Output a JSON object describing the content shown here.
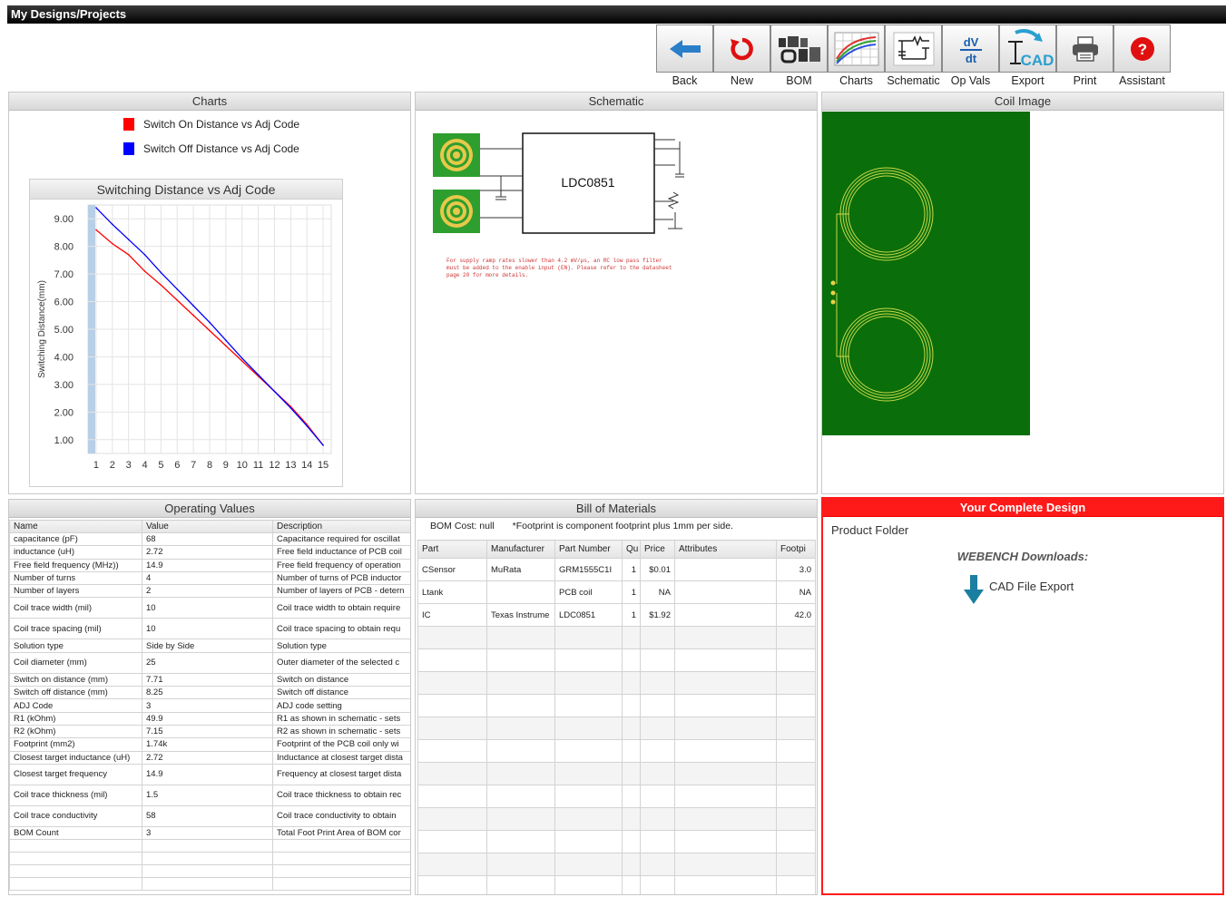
{
  "title": "My Designs/Projects",
  "toolbar": [
    {
      "label": "Back",
      "icon": "back-arrow-icon"
    },
    {
      "label": "New",
      "icon": "refresh-icon"
    },
    {
      "label": "BOM",
      "icon": "bom-icon"
    },
    {
      "label": "Charts",
      "icon": "charts-icon"
    },
    {
      "label": "Schematic",
      "icon": "schematic-icon"
    },
    {
      "label": "Op Vals",
      "icon": "dv-dt-icon"
    },
    {
      "label": "Export",
      "icon": "cad-export-icon"
    },
    {
      "label": "Print",
      "icon": "printer-icon"
    },
    {
      "label": "Assistant",
      "icon": "help-icon"
    }
  ],
  "panels": {
    "charts": "Charts",
    "schematic": "Schematic",
    "coil_image": "Coil Image",
    "operating_values": "Operating Values",
    "bom": "Bill of Materials",
    "complete": "Your Complete Design"
  },
  "colors": {
    "on_series": "#ff0000",
    "off_series": "#0000ff",
    "pcb_green": "#0a6e0a",
    "accent_red": "#ff1a1a"
  },
  "chart_data": {
    "type": "line",
    "title": "Switching Distance vs Adj Code",
    "ylabel": "Switching Distance(mm)",
    "xlabel": "",
    "x": [
      1,
      2,
      3,
      4,
      5,
      6,
      7,
      8,
      9,
      10,
      11,
      12,
      13,
      14,
      15
    ],
    "xlim": [
      0.5,
      15.5
    ],
    "ylim": [
      0.5,
      9.5
    ],
    "yticks": [
      "1.00",
      "2.00",
      "3.00",
      "4.00",
      "5.00",
      "6.00",
      "7.00",
      "8.00",
      "9.00"
    ],
    "legend_position": "top",
    "series": [
      {
        "name": "Switch On Distance vs Adj Code",
        "color": "#ff0000",
        "values": [
          8.6,
          8.1,
          7.7,
          7.1,
          6.6,
          6.05,
          5.5,
          4.95,
          4.4,
          3.85,
          3.3,
          2.75,
          2.2,
          1.55,
          0.8
        ]
      },
      {
        "name": "Switch Off Distance vs Adj Code",
        "color": "#0000ff",
        "values": [
          9.4,
          8.8,
          8.25,
          7.7,
          7.05,
          6.45,
          5.85,
          5.25,
          4.6,
          3.95,
          3.35,
          2.75,
          2.15,
          1.5,
          0.8
        ]
      }
    ]
  },
  "schematic": {
    "chip": "LDC0851",
    "note": "For supply ramp rates slower than 4.2 mV/µs, an RC low pass filter must be added to the enable input (EN). Please refer to the datasheet page 20 for more details."
  },
  "opvals": {
    "headers": [
      "Name",
      "Value",
      "Description"
    ],
    "rows": [
      [
        "capacitance (pF)",
        "68",
        "Capacitance required for oscillat"
      ],
      [
        "inductance (uH)",
        "2.72",
        "Free field inductance of PCB coil"
      ],
      [
        "Free field frequency (MHz))",
        "14.9",
        "Free field frequency of operation"
      ],
      [
        "Number of turns",
        "4",
        "Number of turns of PCB inductor"
      ],
      [
        "Number of layers",
        "2",
        "Number of layers of PCB - detern"
      ],
      [
        "Coil trace width (mil)",
        "10",
        "Coil trace width to obtain require"
      ],
      [
        "Coil trace spacing (mil)",
        "10",
        "Coil trace spacing to obtain requ"
      ],
      [
        "Solution type",
        "Side by Side",
        "Solution type"
      ],
      [
        "Coil diameter (mm)",
        "25",
        "Outer diameter of the selected c"
      ],
      [
        "Switch on distance (mm)",
        "7.71",
        "Switch on distance"
      ],
      [
        "Switch off distance (mm)",
        "8.25",
        "Switch off distance"
      ],
      [
        "ADJ Code",
        "3",
        "ADJ code setting"
      ],
      [
        "R1 (kOhm)",
        "49.9",
        "R1 as shown in schematic - sets"
      ],
      [
        "R2 (kOhm)",
        "7.15",
        "R2 as shown in schematic - sets"
      ],
      [
        "Footprint (mm2)",
        "1.74k",
        "Footprint of the PCB coil only wi"
      ],
      [
        "Closest target inductance (uH)",
        "2.72",
        "Inductance at closest target dista"
      ],
      [
        "Closest target frequency",
        "14.9",
        "Frequency at closest target dista"
      ],
      [
        "Coil trace thickness (mil)",
        "1.5",
        "Coil trace thickness to obtain rec"
      ],
      [
        "Coil trace conductivity",
        "58",
        "Coil trace conductivity to obtain"
      ],
      [
        "BOM Count",
        "3",
        "Total Foot Print Area of BOM cor"
      ]
    ]
  },
  "bom": {
    "cost": "BOM Cost: null",
    "footnote": "*Footprint is component footprint plus 1mm per side.",
    "headers": [
      "Part",
      "Manufacturer",
      "Part Number",
      "Qu",
      "Price",
      "Attributes",
      "Footpi"
    ],
    "rows": [
      [
        "CSensor",
        "MuRata",
        "GRM1555C1I",
        "1",
        "$0.01",
        "",
        "3.0"
      ],
      [
        "Ltank",
        "",
        "PCB coil",
        "1",
        "NA",
        "",
        "NA"
      ],
      [
        "IC",
        "Texas Instrume",
        "LDC0851",
        "1",
        "$1.92",
        "",
        "42.0"
      ]
    ]
  },
  "complete": {
    "product_folder": "Product Folder",
    "downloads": "WEBENCH Downloads:",
    "cad_export": "CAD File Export"
  }
}
